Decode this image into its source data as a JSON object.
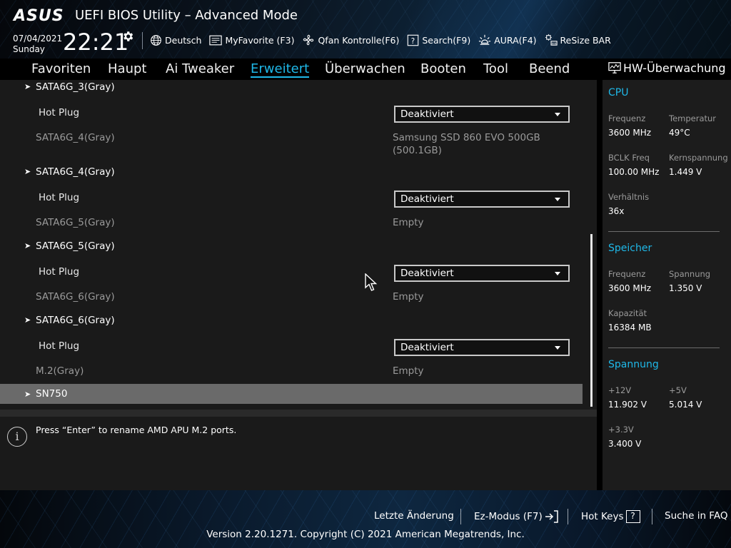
{
  "header": {
    "brand": "ASUS",
    "title": "UEFI BIOS Utility – Advanced Mode",
    "date": "07/04/2021",
    "day": "Sunday",
    "time": "22:21",
    "toolbar": [
      {
        "label": "Deutsch",
        "icon": "globe-icon"
      },
      {
        "label": "MyFavorite (F3)",
        "icon": "favorite-list-icon"
      },
      {
        "label": "Qfan Kontrolle(F6)",
        "icon": "fan-icon"
      },
      {
        "label": "Search(F9)",
        "icon": "search-help-icon"
      },
      {
        "label": "AURA(F4)",
        "icon": "aura-light-icon"
      },
      {
        "label": "ReSize BAR",
        "icon": "resize-bar-icon"
      }
    ]
  },
  "nav": {
    "tabs": [
      "Favoriten",
      "Haupt",
      "Ai Tweaker",
      "Erweitert",
      "Überwachen",
      "Booten",
      "Tool",
      "Beend"
    ],
    "active": "Erweitert"
  },
  "main": {
    "rows": [
      {
        "type": "submenu",
        "label": "SATA6G_3(Gray)"
      },
      {
        "type": "setting",
        "label": "Hot Plug",
        "value": "Deaktiviert"
      },
      {
        "type": "info",
        "label": "SATA6G_4(Gray)",
        "value": "Samsung SSD 860 EVO 500GB",
        "value2": "(500.1GB)"
      },
      {
        "type": "submenu",
        "label": "SATA6G_4(Gray)"
      },
      {
        "type": "setting",
        "label": "Hot Plug",
        "value": "Deaktiviert"
      },
      {
        "type": "info",
        "label": "SATA6G_5(Gray)",
        "value": "Empty"
      },
      {
        "type": "submenu",
        "label": "SATA6G_5(Gray)"
      },
      {
        "type": "setting",
        "label": "Hot Plug",
        "value": "Deaktiviert"
      },
      {
        "type": "info",
        "label": "SATA6G_6(Gray)",
        "value": "Empty"
      },
      {
        "type": "submenu",
        "label": "SATA6G_6(Gray)"
      },
      {
        "type": "setting",
        "label": "Hot Plug",
        "value": "Deaktiviert"
      },
      {
        "type": "info",
        "label": "M.2(Gray)",
        "value": "Empty"
      },
      {
        "type": "submenu-selected",
        "label": "SN750"
      }
    ]
  },
  "help": {
    "text": "Press “Enter” to rename AMD APU M.2 ports."
  },
  "hw_monitor": {
    "title": "HW-Überwachung",
    "cpu": {
      "section": "CPU",
      "freq_label": "Frequenz",
      "freq_value": "3600 MHz",
      "temp_label": "Temperatur",
      "temp_value": "49°C",
      "bclk_label": "BCLK Freq",
      "bclk_value": "100.00 MHz",
      "core_v_label": "Kernspannung",
      "core_v_value": "1.449 V",
      "ratio_label": "Verhältnis",
      "ratio_value": "36x"
    },
    "memory": {
      "section": "Speicher",
      "freq_label": "Frequenz",
      "freq_value": "3600 MHz",
      "volt_label": "Spannung",
      "volt_value": "1.350 V",
      "cap_label": "Kapazität",
      "cap_value": "16384 MB"
    },
    "voltage": {
      "section": "Spannung",
      "v12_label": "+12V",
      "v12_value": "11.902 V",
      "v5_label": "+5V",
      "v5_value": "5.014 V",
      "v33_label": "+3.3V",
      "v33_value": "3.400 V"
    }
  },
  "footer": {
    "last_change": "Letzte Änderung",
    "ez_mode": "Ez-Modus (F7)",
    "hot_keys": "Hot Keys",
    "faq": "Suche in FAQ",
    "copyright": "Version 2.20.1271. Copyright (C) 2021 American Megatrends, Inc."
  }
}
